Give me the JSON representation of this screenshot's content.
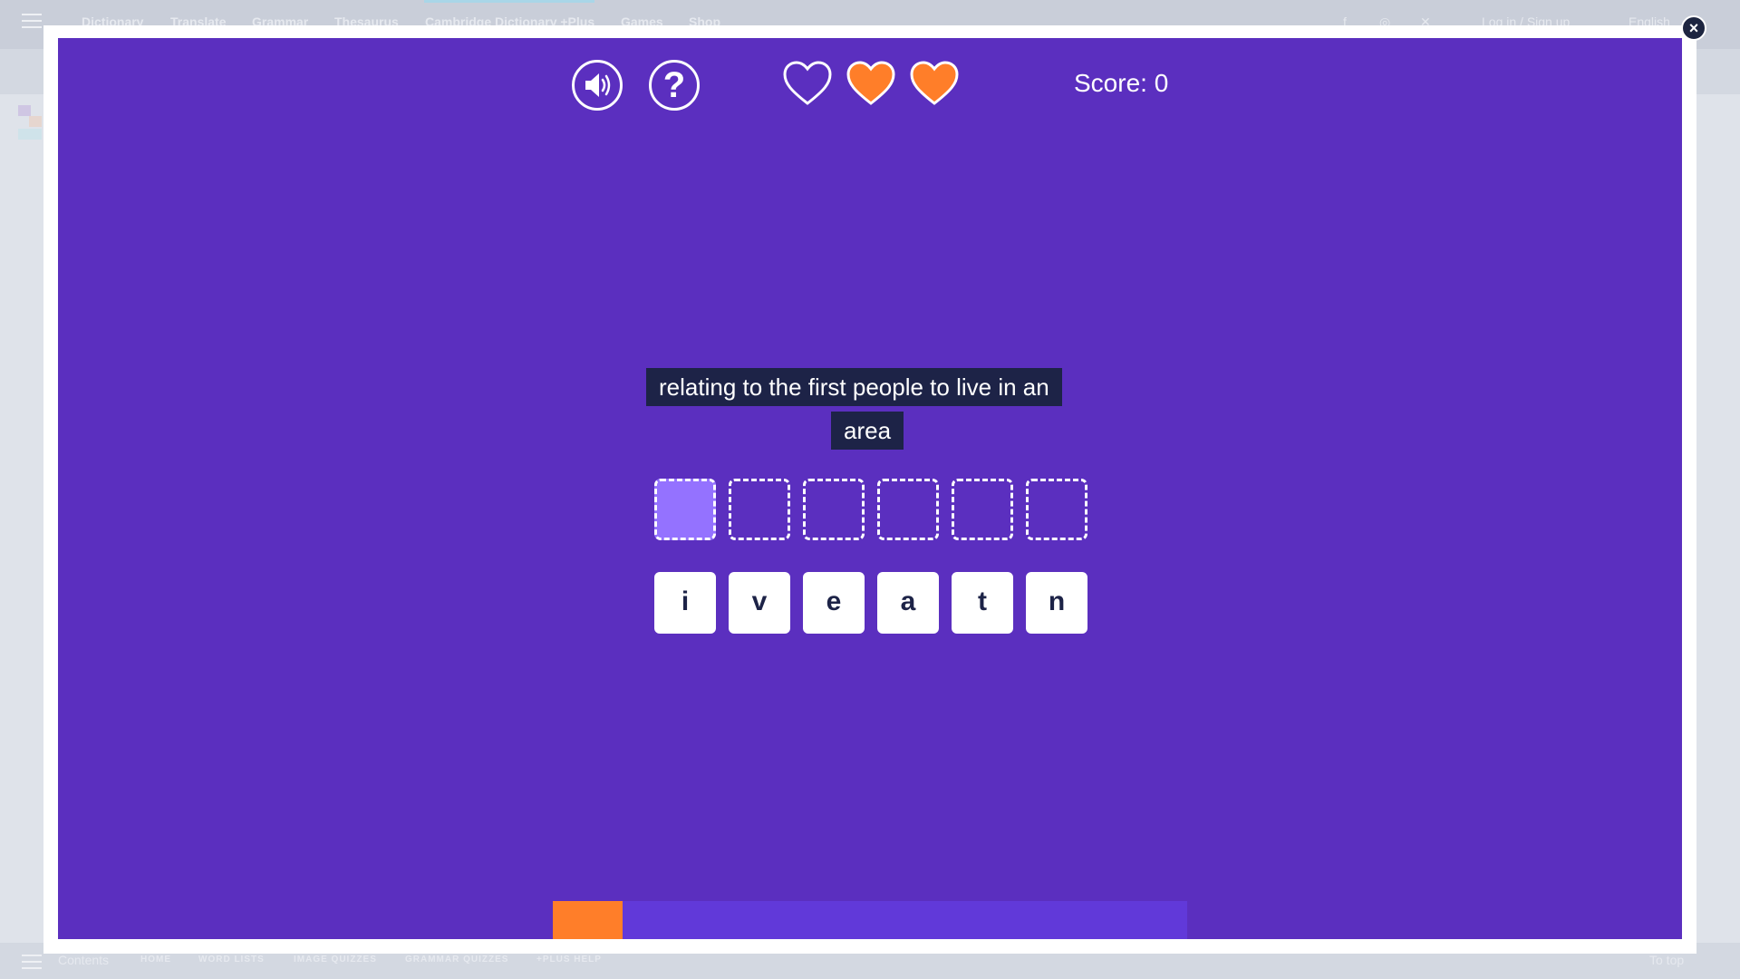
{
  "site": {
    "nav": [
      "Dictionary",
      "Translate",
      "Grammar",
      "Thesaurus",
      "Cambridge Dictionary +Plus",
      "Games",
      "Shop"
    ],
    "right": [
      "f",
      "◎",
      "✕",
      "Log in / Sign up",
      "English"
    ],
    "footer": [
      "Contents",
      "HOME",
      "WORD LISTS",
      "IMAGE QUIZZES",
      "GRAMMAR QUIZZES",
      "+PLUS HELP",
      "To top"
    ]
  },
  "game": {
    "close_label": "×",
    "sound_icon": "speaker-icon",
    "help_label": "?",
    "lives": {
      "total": 3,
      "remaining": 2
    },
    "score_text": "Score: 0",
    "clue_lines": [
      "relating to the first people to live in an",
      "area"
    ],
    "slots": 6,
    "active_slot": 0,
    "tiles": [
      "i",
      "v",
      "e",
      "a",
      "t",
      "n"
    ],
    "timer_fraction": 0.11,
    "colors": {
      "background": "#5b2fbf",
      "heart_full": "#ff7e29",
      "timer_fill": "#ff7e29",
      "clue_bg": "#1d2347",
      "active_slot": "#9472ff"
    }
  }
}
